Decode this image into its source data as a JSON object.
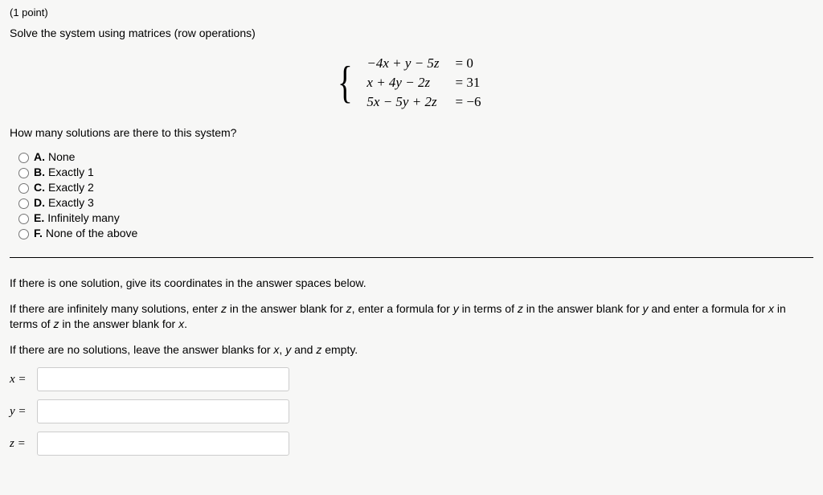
{
  "points": "(1 point)",
  "instruction": "Solve the system using matrices (row operations)",
  "equations": [
    {
      "lhs": "−4x + y − 5z",
      "rhs": "= 0"
    },
    {
      "lhs": "x + 4y − 2z",
      "rhs": "= 31"
    },
    {
      "lhs": "5x − 5y + 2z",
      "rhs": "= −6"
    }
  ],
  "question": "How many solutions are there to this system?",
  "options": [
    {
      "letter": "A.",
      "text": "None"
    },
    {
      "letter": "B.",
      "text": "Exactly 1"
    },
    {
      "letter": "C.",
      "text": "Exactly 2"
    },
    {
      "letter": "D.",
      "text": "Exactly 3"
    },
    {
      "letter": "E.",
      "text": "Infinitely many"
    },
    {
      "letter": "F.",
      "text": "None of the above"
    }
  ],
  "explain1": "If there is one solution, give its coordinates in the answer spaces below.",
  "explain2_parts": {
    "p1": "If there are infinitely many solutions, enter ",
    "z1": "z",
    "p2": " in the answer blank for ",
    "z2": "z",
    "p3": ", enter a formula for ",
    "y1": "y",
    "p4": " in terms of ",
    "z3": "z",
    "p5": " in the answer blank for ",
    "y2": "y",
    "p6": " and enter a formula for ",
    "x1": "x",
    "p7": " in terms of ",
    "z4": "z",
    "p8": " in the answer blank for ",
    "x2": "x",
    "p9": "."
  },
  "explain3_parts": {
    "p1": "If there are no solutions, leave the answer blanks for ",
    "x": "x",
    "c1": ", ",
    "y": "y",
    "c2": " and ",
    "z": "z",
    "p2": " empty."
  },
  "answers": {
    "x_label": "x =",
    "y_label": "y =",
    "z_label": "z ="
  }
}
